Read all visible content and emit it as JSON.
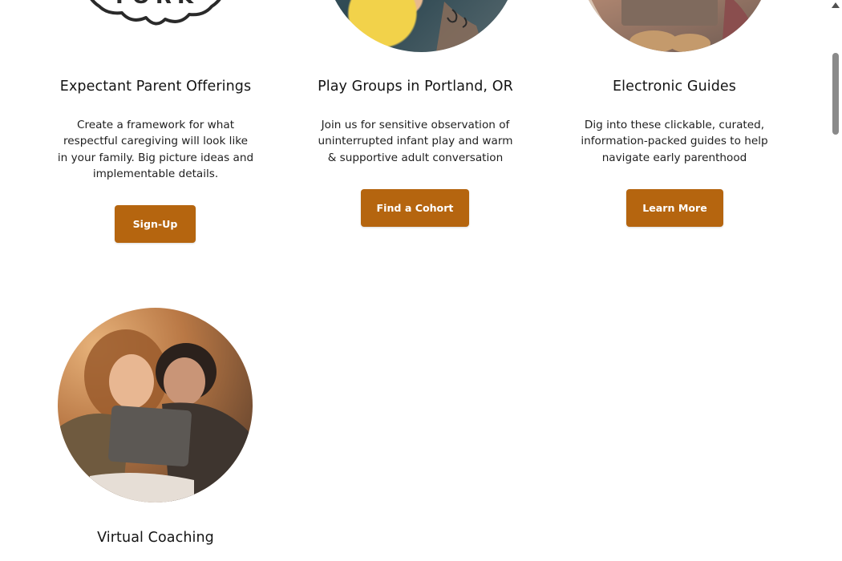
{
  "cards": [
    {
      "title": "Expectant Parent Offerings",
      "description": "Create a framework for what respectful caregiving will look like in your family. Big picture ideas and implementable details.",
      "button": "Sign-Up",
      "image": "stork-logo",
      "logo_text": "TORK"
    },
    {
      "title": "Play Groups in Portland, OR",
      "description": "Join us for sensitive observation of uninterrupted infant play and warm & supportive adult conversation",
      "button": "Find a Cohort",
      "image": "parent-holding-baby-photo"
    },
    {
      "title": "Electronic Guides",
      "description": "Dig into these clickable, curated, information-packed guides to help navigate early parenthood",
      "button": "Learn More",
      "image": "laptop-on-lap-photo"
    },
    {
      "title": "Virtual Coaching",
      "image": "couple-with-laptop-photo"
    }
  ],
  "colors": {
    "button_bg": "#b5650f",
    "button_text": "#ffffff",
    "background": "#ffffff",
    "heading": "#141414"
  },
  "icons": {
    "scroll_up": "triangle-up-icon"
  }
}
